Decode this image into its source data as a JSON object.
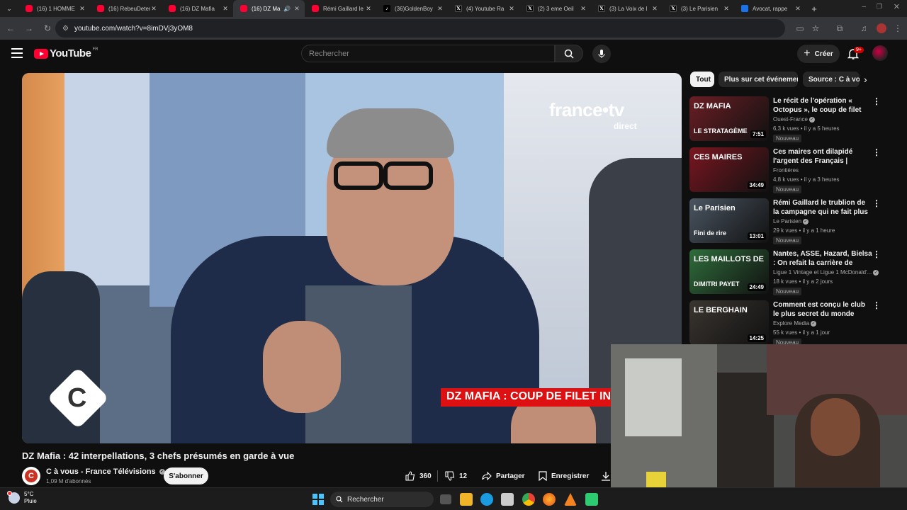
{
  "browser": {
    "tabs": [
      {
        "icon": "youtube",
        "label": "(16) 1 HOMME"
      },
      {
        "icon": "youtube",
        "label": "(16) RebeuDeter"
      },
      {
        "icon": "youtube",
        "label": "(16) DZ Mafia"
      },
      {
        "icon": "youtube",
        "label": "(16) DZ Ma",
        "active": true,
        "audio": true
      },
      {
        "icon": "youtube",
        "label": "Rémi Gaillard le"
      },
      {
        "icon": "tiktok",
        "label": "(36)GoldenBoy"
      },
      {
        "icon": "x",
        "label": "(4) Youtube Ra"
      },
      {
        "icon": "x",
        "label": "(2) 3 eme Oeil"
      },
      {
        "icon": "x",
        "label": "(3) La Voix de l"
      },
      {
        "icon": "x",
        "label": "(3) Le Parisien"
      },
      {
        "icon": "doc",
        "label": "Avocat, rappe"
      }
    ],
    "new_tab": "+",
    "url": "youtube.com/watch?v=8imDVj3yOM8"
  },
  "yt": {
    "logo_text": "YouTube",
    "logo_country": "FR",
    "search_placeholder": "Rechercher",
    "create_label": "Créer",
    "notif_count": "9+"
  },
  "video": {
    "overlay_brand": "france•tv",
    "overlay_sub": "direct",
    "lower_third": "DZ MAFIA : COUP DE FILET IN",
    "title": "DZ Mafia : 42 interpellations, 3 chefs présumés en garde à vue",
    "channel": "C à vous - France Télévisions",
    "subscribers": "1,09 M d'abonnés",
    "subscribe_label": "S'abonner",
    "likes": "360",
    "dislikes": "12",
    "share_label": "Partager",
    "save_label": "Enregistrer"
  },
  "chips": [
    "Tout",
    "Plus sur cet événement",
    "Source : C à vous"
  ],
  "recommendations": [
    {
      "title": "Le récit de l'opération « Octopus », le coup de filet contre la DZ ...",
      "channel": "Ouest-France",
      "verified": true,
      "meta": "6,3 k vues • il y a 5 heures",
      "badge": "Nouveau",
      "duration": "7:51",
      "thumb_text": "DZ MAFIA",
      "thumb_text2": "LE STRATAGÈME",
      "thumb_color": "#6b1e24"
    },
    {
      "title": "Ces maires ont dilapidé l'argent des Français | Documentaire",
      "channel": "Frontières",
      "verified": false,
      "meta": "4,8 k vues • il y a 3 heures",
      "badge": "Nouveau",
      "duration": "34:49",
      "thumb_text": "CES MAIRES",
      "thumb_text2": "",
      "thumb_color": "#7a1620"
    },
    {
      "title": "Rémi Gaillard le trublion de la campagne qui ne fait plus rire ...",
      "channel": "Le Parisien",
      "verified": true,
      "meta": "29 k vues • il y a 1 heure",
      "badge": "Nouveau",
      "duration": "13:01",
      "thumb_text": "Le Parisien",
      "thumb_text2": "Fini de rire",
      "thumb_color": "#4b5663"
    },
    {
      "title": "Nantes, ASSE, Hazard, Bielsa : On refait la carrière de Dimitri ...",
      "channel": "Ligue 1 Vintage et Ligue 1 McDonald'...",
      "verified": true,
      "meta": "18 k vues • il y a 2 jours",
      "badge": "Nouveau",
      "duration": "24:49",
      "thumb_text": "LES MAILLOTS DE",
      "thumb_text2": "DIMITRI PAYET",
      "thumb_color": "#2f6d3b"
    },
    {
      "title": "Comment est conçu le club le plus secret du monde",
      "channel": "Explore Media",
      "verified": true,
      "meta": "55 k vues • il y a 1 jour",
      "badge": "Nouveau",
      "duration": "14:25",
      "thumb_text": "LE BERGHAIN",
      "thumb_text2": "",
      "thumb_color": "#3a3530"
    }
  ],
  "taskbar": {
    "weather_temp": "5°C",
    "weather_desc": "Pluie",
    "search_label": "Rechercher"
  }
}
